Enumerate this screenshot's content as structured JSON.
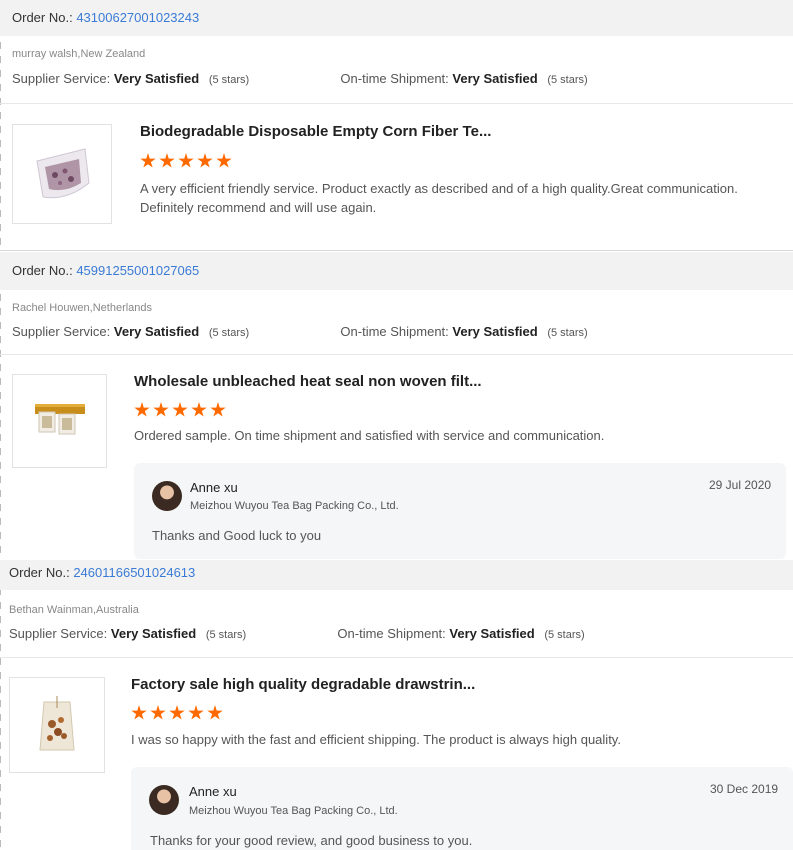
{
  "labels": {
    "order_no": "Order No.:",
    "supplier_service": "Supplier Service:",
    "ontime_shipment": "On-time Shipment:"
  },
  "reviews": [
    {
      "order_number": "43100627001023243",
      "buyer": "murray walsh,New Zealand",
      "supplier_rating": "Very Satisfied",
      "supplier_stars": "(5 stars)",
      "shipment_rating": "Very Satisfied",
      "shipment_stars": "(5 stars)",
      "product_title": "Biodegradable Disposable Empty Corn Fiber Te...",
      "product_image": "tea-bag-filled-icon",
      "star_rating": 5,
      "comment": "A very efficient friendly service.  Product exactly as described and of a high quality.Great communication. Definitely recommend and will use again."
    },
    {
      "order_number": "45991255001027065",
      "buyer": "Rachel Houwen,Netherlands",
      "supplier_rating": "Very Satisfied",
      "supplier_stars": "(5 stars)",
      "shipment_rating": "Very Satisfied",
      "shipment_stars": "(5 stars)",
      "product_title": "Wholesale unbleached heat seal non woven filt...",
      "product_image": "tea-bags-rack-icon",
      "star_rating": 5,
      "comment": "Ordered sample. On time shipment and satisfied with service and communication.",
      "reply": {
        "name": "Anne xu",
        "company": "Meizhou Wuyou Tea Bag Packing Co., Ltd.",
        "date": "29 Jul 2020",
        "text": "Thanks and Good luck to you"
      }
    },
    {
      "order_number": "24601166501024613",
      "buyer": "Bethan Wainman,Australia",
      "supplier_rating": "Very Satisfied",
      "supplier_stars": "(5 stars)",
      "shipment_rating": "Very Satisfied",
      "shipment_stars": "(5 stars)",
      "product_title": "Factory sale high quality degradable drawstrin...",
      "product_image": "drawstring-tea-bag-icon",
      "star_rating": 5,
      "comment": "I was so happy with the fast and efficient shipping. The product is always high quality.",
      "reply": {
        "name": "Anne xu",
        "company": "Meizhou Wuyou Tea Bag Packing Co., Ltd.",
        "date": "30 Dec 2019",
        "text": "Thanks for your good review, and good business to you."
      }
    }
  ],
  "colors": {
    "accent_link": "#3a7bd5",
    "star": "#ff6a00",
    "order_bar_bg": "#f2f2f2",
    "reply_bg": "#f5f6f8"
  }
}
